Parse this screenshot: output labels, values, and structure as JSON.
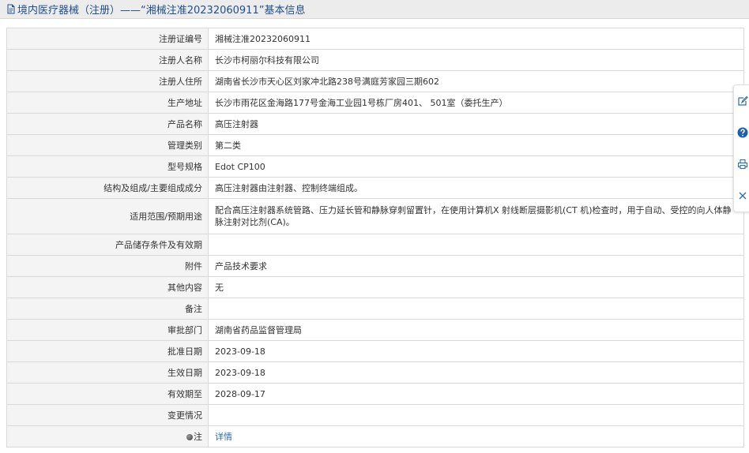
{
  "header": {
    "title": "境内医疗器械（注册）——“湘械注准20232060911”基本信息"
  },
  "icons": {
    "title": "document-icon",
    "toolbar": [
      "edit-icon",
      "help-icon",
      "print-icon",
      "close-icon"
    ]
  },
  "colors": {
    "title_text": "#1f4e8c",
    "link": "#2b6cb0",
    "label_bg": "#f4f4f4",
    "border": "#d9d9d9"
  },
  "rows": [
    {
      "label": "注册证编号",
      "value": "湘械注准20232060911"
    },
    {
      "label": "注册人名称",
      "value": "长沙市柯丽尔科技有限公司"
    },
    {
      "label": "注册人住所",
      "value": "湖南省长沙市天心区刘家冲北路238号满庭芳家园三期602"
    },
    {
      "label": "生产地址",
      "value": "长沙市雨花区金海路177号金海工业园1号栋厂房401、 501室（委托生产）"
    },
    {
      "label": "产品名称",
      "value": "高压注射器"
    },
    {
      "label": "管理类别",
      "value": "第二类"
    },
    {
      "label": "型号规格",
      "value": "Edot CP100"
    },
    {
      "label": "结构及组成/主要组成成分",
      "value": "高压注射器由注射器、控制终端组成。"
    },
    {
      "label": "适用范围/预期用途",
      "value": "配合高压注射器系统管路、压力延长管和静脉穿刺留置针，在使用计算机X 射线断层摄影机(CT 机)检查时，用于自动、受控的向人体静脉注射对比剂(CA)。"
    },
    {
      "label": "产品储存条件及有效期",
      "value": ""
    },
    {
      "label": "附件",
      "value": "产品技术要求"
    },
    {
      "label": "其他内容",
      "value": "无"
    },
    {
      "label": "备注",
      "value": ""
    },
    {
      "label": "审批部门",
      "value": "湖南省药品监督管理局"
    },
    {
      "label": "批准日期",
      "value": "2023-09-18"
    },
    {
      "label": "生效日期",
      "value": "2023-09-18"
    },
    {
      "label": "有效期至",
      "value": "2028-09-17"
    },
    {
      "label": "变更情况",
      "value": ""
    },
    {
      "label": "注",
      "value": "详情"
    }
  ]
}
